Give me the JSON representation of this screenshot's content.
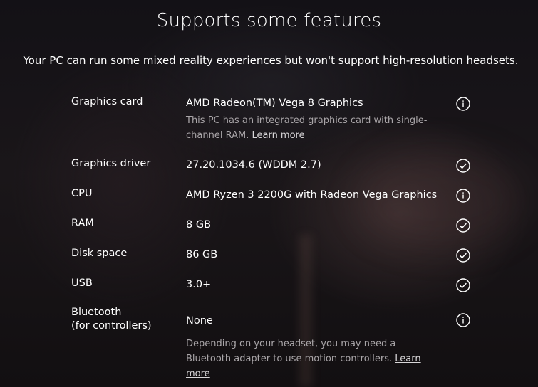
{
  "header": {
    "title": "Supports some features",
    "subtitle": "Your PC can run some mixed reality experiences but won't support high-resolution headsets."
  },
  "rows": [
    {
      "label": "Graphics card",
      "value": "AMD Radeon(TM) Vega 8 Graphics",
      "status": "info-icon",
      "note": "This PC has an integrated graphics card with single-channel RAM.",
      "note_link": "Learn more"
    },
    {
      "label": "Graphics driver",
      "value": "27.20.1034.6 (WDDM 2.7)",
      "status": "check-icon"
    },
    {
      "label": "CPU",
      "value": "AMD Ryzen 3 2200G with Radeon Vega Graphics",
      "status": "info-icon"
    },
    {
      "label": "RAM",
      "value": "8 GB",
      "status": "check-icon"
    },
    {
      "label": "Disk space",
      "value": "86 GB",
      "status": "check-icon"
    },
    {
      "label": "USB",
      "value": "3.0+",
      "status": "check-icon"
    },
    {
      "label_line1": "Bluetooth",
      "label_line2": "(for controllers)",
      "value": "None",
      "status": "info-icon",
      "note": "Depending on your headset, you may need a Bluetooth adapter to use motion controllers.",
      "note_link": "Learn more"
    }
  ]
}
